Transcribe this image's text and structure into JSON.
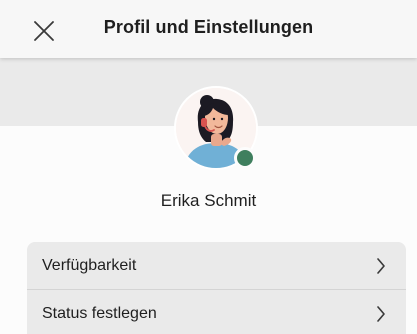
{
  "header": {
    "title": "Profil und Einstellungen",
    "close_icon": "close-icon"
  },
  "profile": {
    "name": "Erika Schmit",
    "avatar_icon": "avatar-illustration",
    "presence_status_color": "#3f7f5e"
  },
  "menu": {
    "items": [
      {
        "label": "Verfügbarkeit",
        "icon": "chevron-right-icon"
      },
      {
        "label": "Status festlegen",
        "icon": "chevron-right-icon"
      }
    ]
  },
  "colors": {
    "header_bg": "#f7f7f7",
    "band_bg": "#eaeaea",
    "content_bg": "#fcfcfc",
    "menu_bg": "#eaeaea",
    "text": "#1f1f1f",
    "presence": "#3f7f5e"
  }
}
